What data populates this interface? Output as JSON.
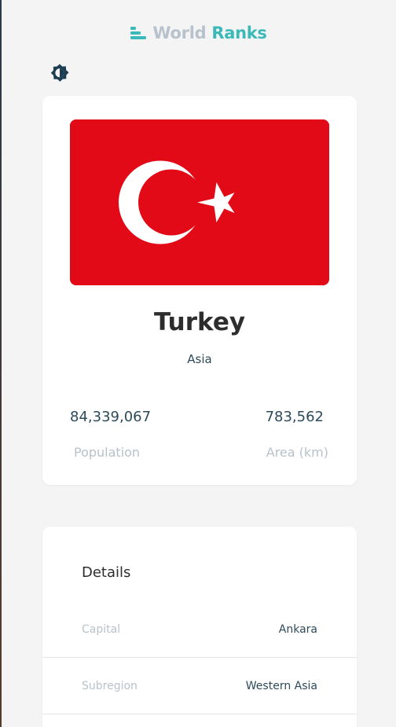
{
  "header": {
    "logo_icon": "bar-rank-icon",
    "title_part1": "World",
    "title_part2": "Ranks"
  },
  "theme_toggle": {
    "icon": "contrast-icon"
  },
  "country": {
    "flag_icon": "turkey-flag",
    "name": "Turkey",
    "region": "Asia",
    "population_value": "84,339,067",
    "population_label": "Population",
    "area_value": "783,562",
    "area_label": "Area (km)"
  },
  "details": {
    "title": "Details",
    "rows": [
      {
        "label": "Capital",
        "value": "Ankara"
      },
      {
        "label": "Subregion",
        "value": "Western Asia"
      }
    ]
  },
  "colors": {
    "accent": "#3bb8b8",
    "muted": "#b8c2cc",
    "flag_red": "#e30a17"
  }
}
